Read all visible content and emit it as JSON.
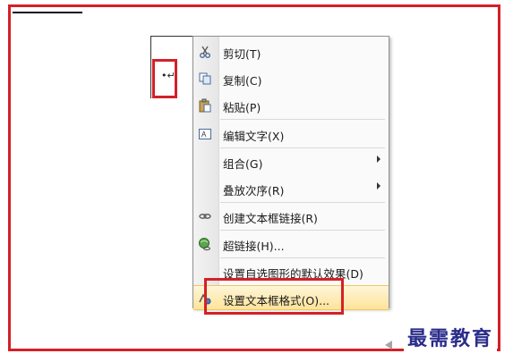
{
  "document": {
    "paragraph_mark": "•↵"
  },
  "context_menu": {
    "items": [
      {
        "label": "剪切(T)",
        "icon": "scissors-icon"
      },
      {
        "label": "复制(C)",
        "icon": "copy-icon"
      },
      {
        "label": "粘贴(P)",
        "icon": "paste-icon"
      },
      {
        "label": "编辑文字(X)",
        "icon": "edit-text-icon"
      },
      {
        "label": "组合(G)",
        "submenu": true
      },
      {
        "label": "叠放次序(R)",
        "submenu": true
      },
      {
        "label": "创建文本框链接(R)",
        "icon": "link-icon"
      },
      {
        "label": "超链接(H)...",
        "icon": "hyperlink-globe-icon"
      },
      {
        "label": "设置自选图形的默认效果(D)"
      },
      {
        "label": "设置文本框格式(O)...",
        "icon": "format-textbox-icon",
        "highlighted": true
      }
    ]
  },
  "watermark": {
    "text": "最需教育"
  },
  "colors": {
    "annotation_red": "#d42027",
    "menu_highlight": "#fde39a",
    "watermark_blue": "#2a2c8a"
  }
}
